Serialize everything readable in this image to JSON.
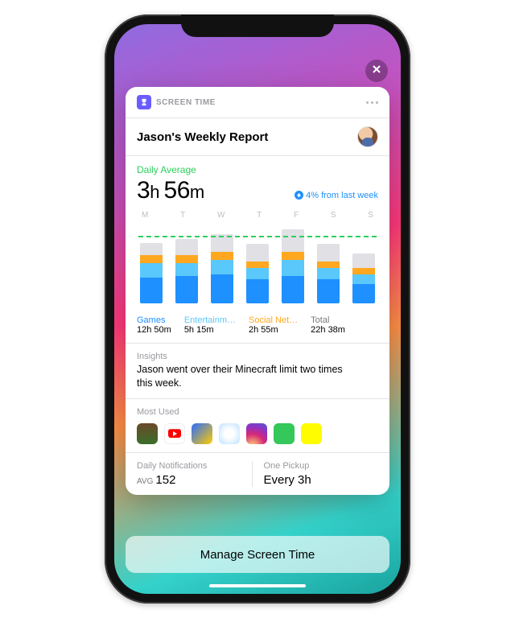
{
  "header": {
    "app_name": "SCREEN TIME",
    "title": "Jason's Weekly Report"
  },
  "summary": {
    "avg_label": "Daily Average",
    "avg_value_h": "3",
    "avg_value_m": "56",
    "trend_text": "4% from last week"
  },
  "chart_data": {
    "type": "bar",
    "days": [
      "M",
      "T",
      "W",
      "T",
      "F",
      "S",
      "S"
    ],
    "segments": [
      "games",
      "entertainment",
      "social",
      "other"
    ],
    "limit_fraction": 0.82,
    "bars": [
      {
        "games": 32,
        "ent": 18,
        "soc": 10,
        "other": 15
      },
      {
        "games": 34,
        "ent": 16,
        "soc": 10,
        "other": 20
      },
      {
        "games": 36,
        "ent": 18,
        "soc": 10,
        "other": 22
      },
      {
        "games": 30,
        "ent": 14,
        "soc": 8,
        "other": 22
      },
      {
        "games": 34,
        "ent": 20,
        "soc": 10,
        "other": 28
      },
      {
        "games": 30,
        "ent": 14,
        "soc": 8,
        "other": 22
      },
      {
        "games": 24,
        "ent": 12,
        "soc": 8,
        "other": 18
      }
    ],
    "max_total": 100
  },
  "legend": {
    "games": {
      "label": "Games",
      "value": "12h 50m"
    },
    "ent": {
      "label": "Entertainm…",
      "value": "5h 15m"
    },
    "soc": {
      "label": "Social Net…",
      "value": "2h 55m"
    },
    "total": {
      "label": "Total",
      "value": "22h 38m"
    }
  },
  "insights": {
    "label": "Insights",
    "text": "Jason went over their Minecraft limit two times this week."
  },
  "most_used": {
    "label": "Most Used",
    "apps": [
      "minecraft",
      "youtube",
      "clash-royale",
      "fortnite",
      "instagram",
      "messages",
      "snapchat"
    ]
  },
  "stats": {
    "notifications": {
      "label": "Daily Notifications",
      "prefix": "AVG",
      "value": "152"
    },
    "pickup": {
      "label": "One Pickup",
      "value": "Every 3h"
    }
  },
  "manage_button": "Manage Screen Time"
}
